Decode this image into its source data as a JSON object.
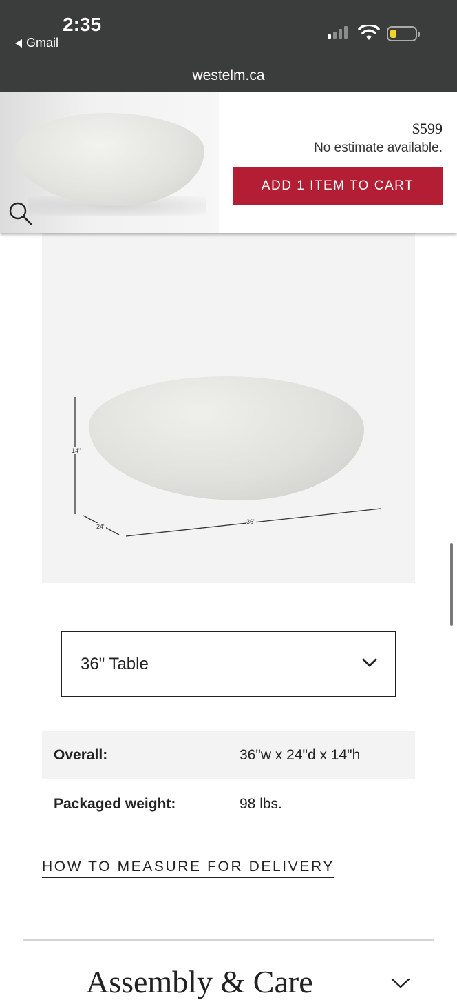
{
  "status_bar": {
    "time": "2:35",
    "back_app": "Gmail"
  },
  "browser": {
    "url": "westelm.ca"
  },
  "sticky_header": {
    "price": "$599",
    "estimate": "No estimate available.",
    "cart_button": "ADD 1 ITEM TO CART",
    "accent_color": "#b41e34"
  },
  "dimension_image": {
    "height_label": "14\"",
    "depth_label": "24\"",
    "width_label": "36\""
  },
  "size_select": {
    "selected": "36\" Table"
  },
  "specs": [
    {
      "label": "Overall:",
      "value": "36\"w x 24\"d x 14\"h"
    },
    {
      "label": "Packaged weight:",
      "value": "98 lbs."
    }
  ],
  "links": {
    "measure": "HOW TO MEASURE FOR DELIVERY"
  },
  "sections": {
    "assembly_title": "Assembly & Care"
  },
  "icons": {
    "search": "search-icon",
    "select_chevron": "chevron-down-icon",
    "assembly_chevron": "chevron-down-icon"
  }
}
